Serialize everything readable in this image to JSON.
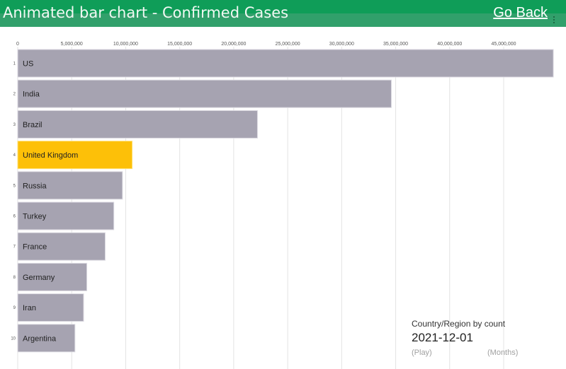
{
  "header": {
    "title": "Animated bar chart - Confirmed Cases",
    "go_back_label": "Go Back",
    "menu_icon": "kebab-menu-icon"
  },
  "colors": {
    "header_bg": "#0f9d58",
    "bar_default": "#a6a3b1",
    "bar_highlight": "#fdc008",
    "gridline": "#e3e3e3"
  },
  "info": {
    "subtitle": "Country/Region by count",
    "date": "2021-12-01"
  },
  "controls": {
    "play_label": "(Play)",
    "interval_label": "(Months)"
  },
  "chart_data": {
    "type": "bar",
    "orientation": "horizontal",
    "title": "Animated bar chart - Confirmed Cases",
    "xlabel": "",
    "ylabel": "",
    "xlim": [
      0,
      50000000
    ],
    "grid": true,
    "ticks": [
      0,
      5000000,
      10000000,
      15000000,
      20000000,
      25000000,
      30000000,
      35000000,
      40000000,
      45000000
    ],
    "tick_labels": [
      "0",
      "5,000,000",
      "10,000,000",
      "15,000,000",
      "20,000,000",
      "25,000,000",
      "30,000,000",
      "35,000,000",
      "40,000,000",
      "45,000,000"
    ],
    "ranks": [
      "1",
      "2",
      "3",
      "4",
      "5",
      "6",
      "7",
      "8",
      "9",
      "10"
    ],
    "categories": [
      "US",
      "India",
      "Brazil",
      "United Kingdom",
      "Russia",
      "Turkey",
      "France",
      "Germany",
      "Iran",
      "Argentina"
    ],
    "values": [
      49600000,
      34600000,
      22200000,
      10600000,
      9700000,
      8900000,
      8100000,
      6400000,
      6100000,
      5300000
    ],
    "highlight": "United Kingdom",
    "date": "2021-12-01"
  }
}
